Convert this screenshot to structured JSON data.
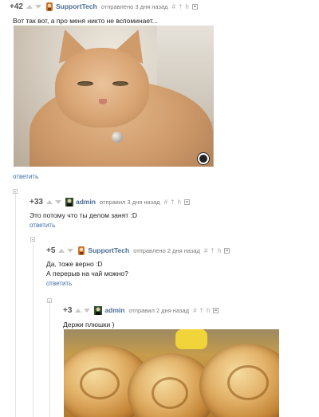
{
  "comments": [
    {
      "rating": "+42",
      "author": "SupportTech",
      "meta": "отправлено 3 дня назад",
      "text_lines": [
        "Вот так вот, а про меня никто не вспоминает..."
      ],
      "reply": "ответить",
      "avatar_color": "#c8732a"
    },
    {
      "rating": "+33",
      "author": "admin",
      "meta": "отправил 3 дня назад",
      "text_lines": [
        "Это потому что ты делом занят :D"
      ],
      "reply": "ответить",
      "avatar_color": "#2f4f2f"
    },
    {
      "rating": "+5",
      "author": "SupportTech",
      "meta": "отправлено 2 дня назад",
      "text_lines": [
        "Да, тоже верно :D",
        "А перерыв на чай можно?"
      ],
      "reply": "ответить",
      "avatar_color": "#c8732a"
    },
    {
      "rating": "+3",
      "author": "admin",
      "meta": "отправил 2 дня назад",
      "text_lines": [
        "Держи плюшки )"
      ],
      "avatar_color": "#2f4f2f"
    }
  ],
  "tool_icons": {
    "link": "#",
    "parent": "†",
    "branch": "h",
    "save": "save-icon"
  },
  "colors": {
    "author_link": "#4a6b94",
    "reply_link": "#3f6fa7"
  }
}
